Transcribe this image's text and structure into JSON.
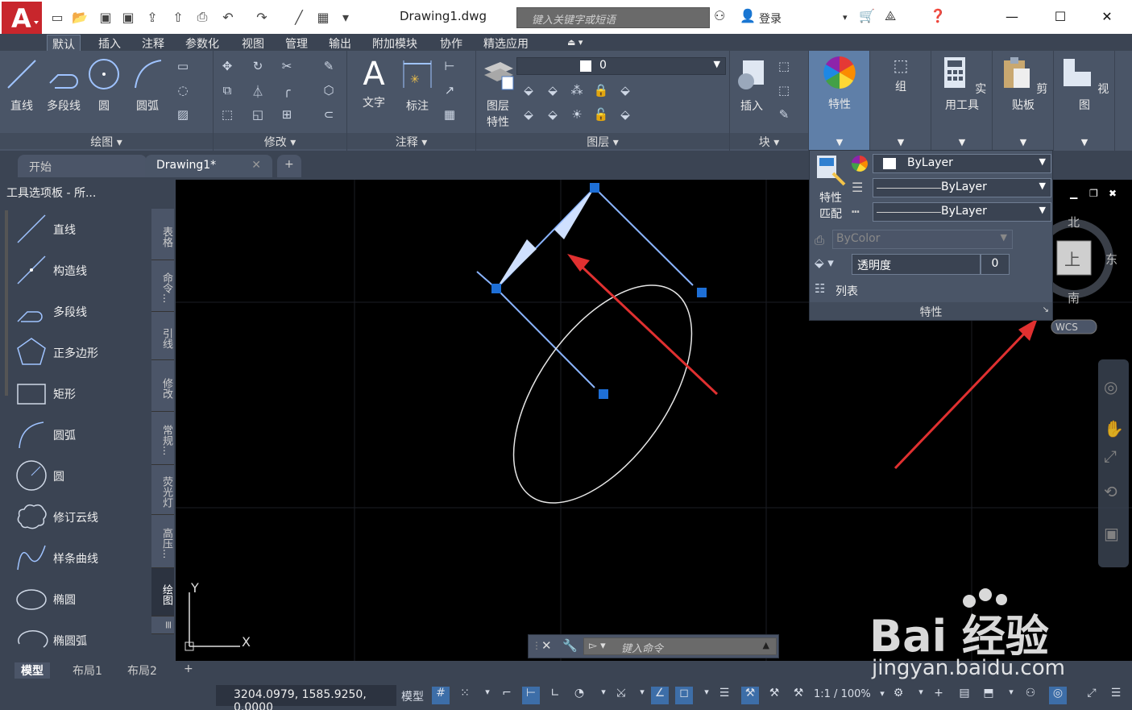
{
  "window": {
    "title": "Drawing1.dwg",
    "search_placeholder": "键入关键字或短语",
    "login": "登录",
    "controls": [
      "minimize",
      "maximize",
      "close"
    ]
  },
  "menu": {
    "tabs": [
      "默认",
      "插入",
      "注释",
      "参数化",
      "视图",
      "管理",
      "输出",
      "附加模块",
      "协作",
      "精选应用"
    ]
  },
  "ribbon": {
    "draw": {
      "tools": [
        "直线",
        "多段线",
        "圆",
        "圆弧"
      ],
      "title": "绘图"
    },
    "modify": {
      "title": "修改"
    },
    "annotation": {
      "tools": [
        "文字",
        "标注"
      ],
      "title": "注释"
    },
    "layers": {
      "tool": [
        "图层",
        "特性"
      ],
      "current_layer": "0",
      "title": "图层"
    },
    "block": {
      "tool": "插入",
      "title": "块"
    },
    "properties_tool": "特性",
    "group_tool": "组",
    "utilities_tool": "实用工具",
    "clipboard_tool": "剪贴板",
    "view_tool": "视图"
  },
  "file_tabs": {
    "start": "开始",
    "drawing": "Drawing1*"
  },
  "tool_palette": {
    "title": "工具选项板 - 所...",
    "items": [
      "直线",
      "构造线",
      "多段线",
      "正多边形",
      "矩形",
      "圆弧",
      "圆",
      "修订云线",
      "样条曲线",
      "椭圆",
      "椭圆弧"
    ],
    "side_tabs": [
      "表格",
      "命令...",
      "引线",
      "修改",
      "常规...",
      "荧光灯",
      "高压...",
      "绘图"
    ]
  },
  "properties_panel": {
    "match_label": [
      "特性",
      "匹配"
    ],
    "color": "ByLayer",
    "linetype": "ByLayer",
    "lineweight": "ByLayer",
    "plot_style": "ByColor",
    "transparency_label": "透明度",
    "transparency_value": "0",
    "list": "列表",
    "footer": "特性"
  },
  "viewcube": {
    "north": "北",
    "south": "南",
    "east": "东",
    "top": "上",
    "wcs": "WCS"
  },
  "ucs": {
    "x": "X",
    "y": "Y"
  },
  "command": {
    "placeholder": "键入命令"
  },
  "layout_tabs": [
    "模型",
    "布局1",
    "布局2"
  ],
  "status": {
    "coordinates": "3204.0979, 1585.9250, 0.0000",
    "model": "模型",
    "scale": "1:1 / 100%"
  },
  "colors": {
    "ribbon_bg": "#4a5567",
    "dark_bg": "#3b4453",
    "accent": "#3d6ea8",
    "selection_blue": "#1e6fd6",
    "arrow_red": "#e03030"
  },
  "watermark": {
    "logo_text": "Bai 经验",
    "url": "jingyan.baidu.com"
  }
}
